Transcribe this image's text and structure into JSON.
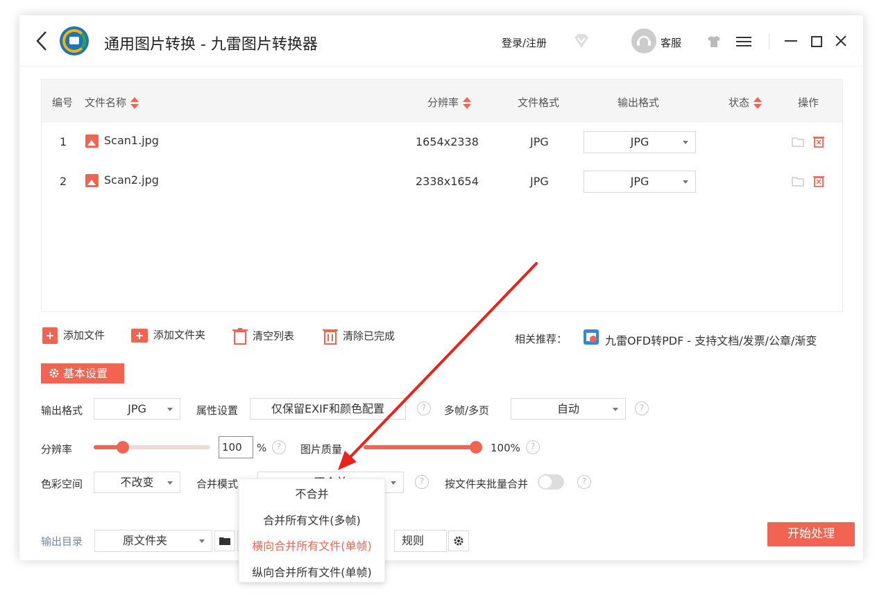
{
  "header": {
    "title": "通用图片转换 - 九雷图片转换器",
    "login": "登录/注册",
    "service": "客服"
  },
  "table": {
    "columns": {
      "index": "编号",
      "name": "文件名称",
      "resolution": "分辨率",
      "format": "文件格式",
      "output": "输出格式",
      "status": "状态",
      "action": "操作"
    },
    "rows": [
      {
        "index": "1",
        "name": "Scan1.jpg",
        "resolution": "1654x2338",
        "format": "JPG",
        "output": "JPG"
      },
      {
        "index": "2",
        "name": "Scan2.jpg",
        "resolution": "2338x1654",
        "format": "JPG",
        "output": "JPG"
      }
    ]
  },
  "toolbar": {
    "add_file": "添加文件",
    "add_folder": "添加文件夹",
    "clear_list": "清空列表",
    "clear_done": "清除已完成",
    "recommend_label": "相关推荐：",
    "recommend_text": "九雷OFD转PDF - 支持文档/发票/公章/渐变"
  },
  "settings": {
    "section_title": "基本设置",
    "output_format_label": "输出格式",
    "output_format_value": "JPG",
    "attr_label": "属性设置",
    "attr_value": "仅保留EXIF和颜色配置",
    "multiframe_label": "多帧/多页",
    "multiframe_value": "自动",
    "resolution_label": "分辨率",
    "resolution_value": "100",
    "resolution_unit": "%",
    "resolution_level": 0.25,
    "quality_label": "图片质量",
    "quality_value": "100%",
    "quality_level": 1.0,
    "color_label": "色彩空间",
    "color_value": "不改变",
    "merge_label": "合并模式",
    "merge_value": "不合并",
    "batch_merge_label": "按文件夹批量合并"
  },
  "merge_dropdown": {
    "options": [
      "不合并",
      "合并所有文件(多帧)",
      "横向合并所有文件(单帧)",
      "纵向合并所有文件(单帧)"
    ],
    "highlighted": "横向合并所有文件(单帧)"
  },
  "output": {
    "label": "输出目录",
    "dir_value": "原文件夹",
    "rule_partial": "规则",
    "start": "开始处理"
  },
  "colors": {
    "accent": "#f06451",
    "annotation_arrow": "#e8231c"
  }
}
